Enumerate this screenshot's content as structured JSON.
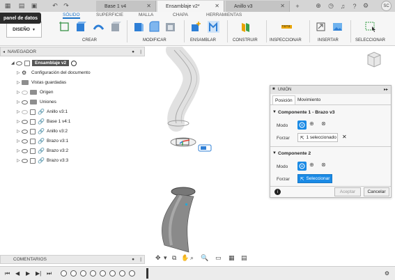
{
  "window": {
    "tabs": [
      {
        "label": "Base 1 v4",
        "active": false
      },
      {
        "label": "Ensamblaje v2*",
        "active": true
      },
      {
        "label": "Anillo v3",
        "active": false
      }
    ],
    "user_initials": "SC"
  },
  "panel_badge": "panel de datos",
  "ribbon": {
    "tabs": [
      "SÓLIDO",
      "SUPERFICIE",
      "MALLA",
      "CHAPA",
      "HERRAMIENTAS"
    ],
    "active_tab": "SÓLIDO",
    "workspace": "DISEÑO",
    "groups": [
      "CREAR",
      "MODIFICAR",
      "ENSAMBLAR",
      "CONSTRUIR",
      "INSPECCIONAR",
      "INSERTAR",
      "SELECCIONAR"
    ]
  },
  "browser": {
    "header": "NAVEGADOR",
    "root": "Ensamblaje v2",
    "items": [
      "Configuración del documento",
      "Vistas guardadas",
      "Origen",
      "Uniones",
      "Anillo v3:1",
      "Base 1 v4:1",
      "Anillo v3:2",
      "Brazo v3:1",
      "Brazo v3:2",
      "Brazo v3:3"
    ]
  },
  "dialog": {
    "title": "UNIÓN",
    "tabs": [
      "Posición",
      "Movimiento"
    ],
    "comp1_title": "Componente 1 - Brazo v3",
    "comp2_title": "Componente 2",
    "mode_label": "Modo",
    "force_label": "Forzar",
    "comp1_selection": "1 seleccionado",
    "comp2_selection": "Seleccionar",
    "ok": "Aceptar",
    "cancel": "Cancelar"
  },
  "comments": "COMENTARIOS",
  "accent": "#1a8ae5"
}
